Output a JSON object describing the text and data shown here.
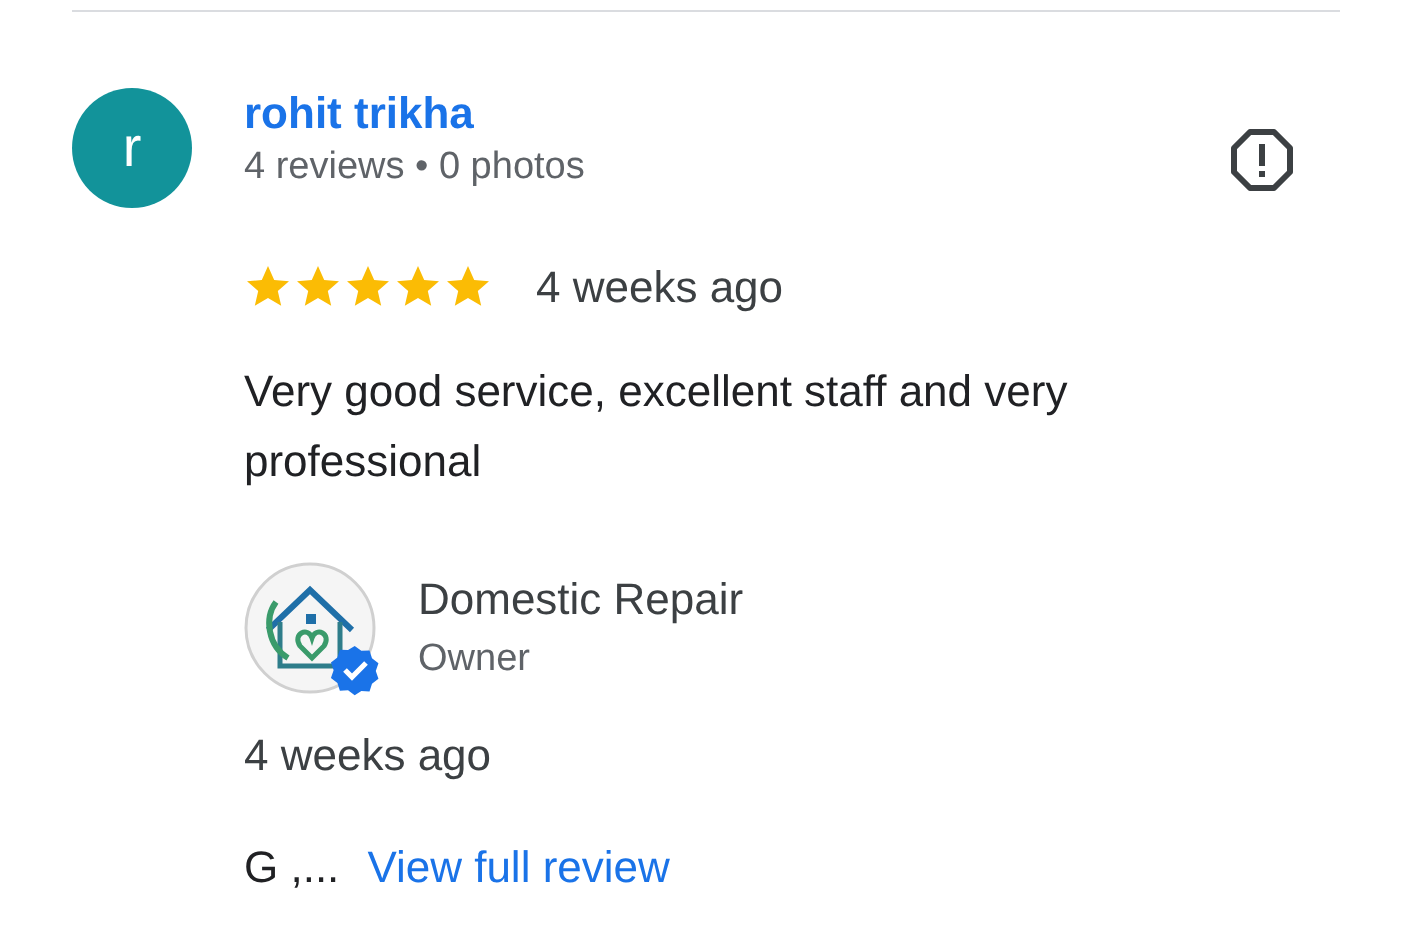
{
  "review": {
    "avatar_letter": "r",
    "author": "rohit trikha",
    "stats": "4 reviews • 0 photos",
    "stars": 5,
    "time": "4 weeks ago",
    "text": "Very good service, excellent staff and very professional"
  },
  "owner_response": {
    "name": "Domestic Repair",
    "role": "Owner",
    "verified": true,
    "time": "4 weeks ago",
    "excerpt": "G ,...",
    "link": "View full review"
  }
}
